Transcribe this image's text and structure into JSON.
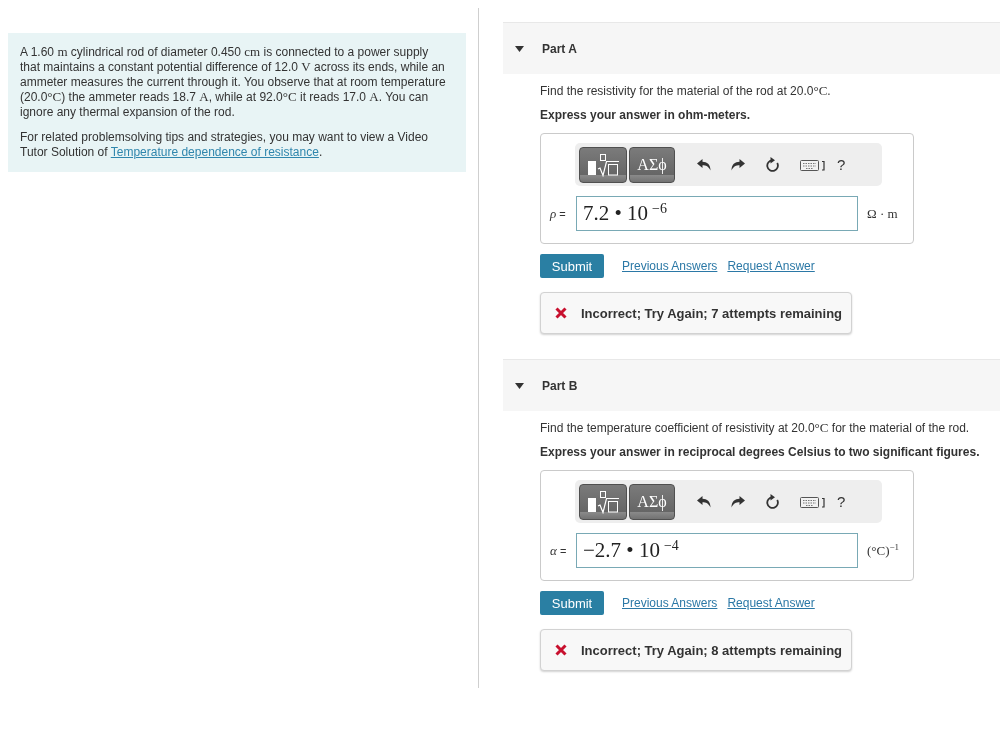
{
  "problem": {
    "paragraphs": [
      {
        "runs": [
          {
            "kind": "text",
            "text": "A 1.60 "
          },
          {
            "kind": "math",
            "text": "m"
          },
          {
            "kind": "text",
            "text": " cylindrical rod of diameter 0.450 "
          },
          {
            "kind": "math",
            "text": "cm"
          },
          {
            "kind": "text",
            "text": " is connected to a power supply that maintains a constant potential difference of 12.0 "
          },
          {
            "kind": "math",
            "text": "V"
          },
          {
            "kind": "text",
            "text": " across its ends, while an ammeter measures the current through it. You observe that at room temperature (20.0"
          },
          {
            "kind": "math",
            "text": "°C"
          },
          {
            "kind": "text",
            "text": ") the ammeter reads 18.7 "
          },
          {
            "kind": "math",
            "text": "A"
          },
          {
            "kind": "text",
            "text": ", while at 92.0"
          },
          {
            "kind": "math",
            "text": "°C"
          },
          {
            "kind": "text",
            "text": " it reads 17.0 "
          },
          {
            "kind": "math",
            "text": "A"
          },
          {
            "kind": "text",
            "text": ". You can ignore any thermal expansion of the rod."
          }
        ]
      },
      {
        "runs": [
          {
            "kind": "text",
            "text": "For related problemsolving tips and strategies, you may want to view a Video Tutor Solution of "
          },
          {
            "kind": "link",
            "text": "Temperature dependence of resistance"
          },
          {
            "kind": "text",
            "text": "."
          }
        ]
      }
    ]
  },
  "parts": [
    {
      "title": "Part A",
      "expanded": true,
      "question": [
        {
          "kind": "text",
          "text": "Find the resistivity for the material of the rod at 20.0"
        },
        {
          "kind": "math",
          "text": "°C"
        },
        {
          "kind": "text",
          "text": "."
        }
      ],
      "instruction": "Express your answer in ohm-meters.",
      "toolbar": {
        "symbols_label": "ΑΣϕ",
        "help_label": "?"
      },
      "variable_label": "*ρ* =",
      "answer": "7.2 • 10$^{−6}$",
      "unit": "Ω · m",
      "submit_label": "Submit",
      "links": [
        "Previous Answers",
        "Request Answer"
      ],
      "feedback": {
        "kind": "incorrect",
        "text": "Incorrect; Try Again; 7 attempts remaining"
      }
    },
    {
      "title": "Part B",
      "expanded": true,
      "question": [
        {
          "kind": "text",
          "text": "Find the temperature coefficient of resistivity at 20.0"
        },
        {
          "kind": "math",
          "text": "°C"
        },
        {
          "kind": "text",
          "text": " for the material of the rod."
        }
      ],
      "instruction": "Express your answer in reciprocal degrees Celsius to two significant figures.",
      "toolbar": {
        "symbols_label": "ΑΣϕ",
        "help_label": "?"
      },
      "variable_label": "*α* =",
      "answer": "−2.7 • 10$^{−4}$",
      "unit": "(°C)$^{−1}$",
      "submit_label": "Submit",
      "links": [
        "Previous Answers",
        "Request Answer"
      ],
      "feedback": {
        "kind": "incorrect",
        "text": "Incorrect; Try Again; 8 attempts remaining"
      }
    }
  ]
}
